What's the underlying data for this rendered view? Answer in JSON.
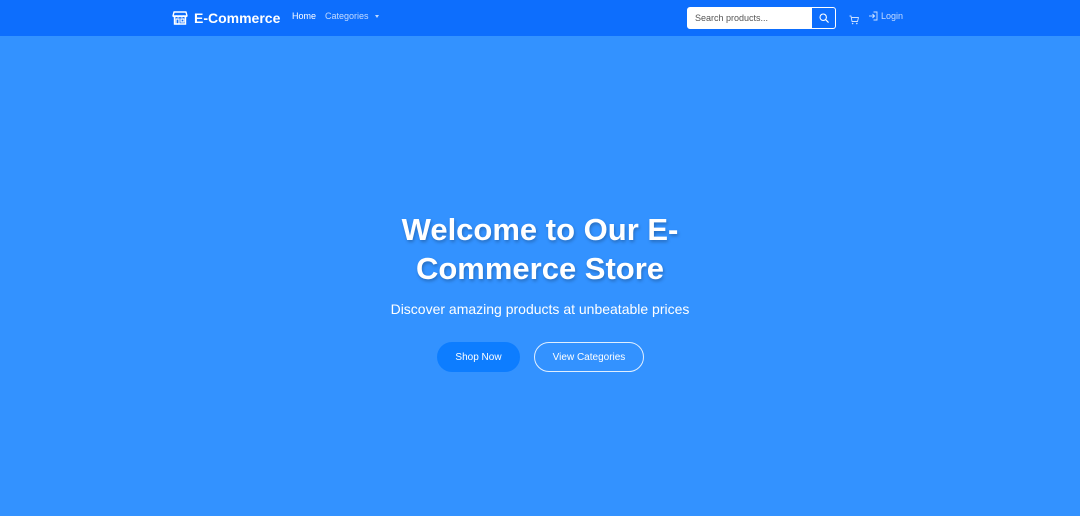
{
  "navbar": {
    "brand": "E-Commerce",
    "brand_icon": "storefront-icon",
    "links": [
      {
        "label": "Home",
        "active": true
      },
      {
        "label": "Categories",
        "has_dropdown": true
      }
    ],
    "search": {
      "placeholder": "Search products...",
      "value": "",
      "button_icon": "search-icon"
    },
    "cart_icon": "cart-icon",
    "login": {
      "label": "Login",
      "icon": "login-icon"
    },
    "colors": {
      "background": "#0d6efd",
      "text": "#ffffff"
    }
  },
  "hero": {
    "title": "Welcome to Our E-Commerce Store",
    "subtitle": "Discover amazing products at unbeatable prices",
    "buttons": [
      {
        "label": "Shop Now",
        "style": "primary"
      },
      {
        "label": "View Categories",
        "style": "outline"
      }
    ],
    "colors": {
      "background": "#3392ff",
      "primary_button": "#0d7dff"
    }
  }
}
